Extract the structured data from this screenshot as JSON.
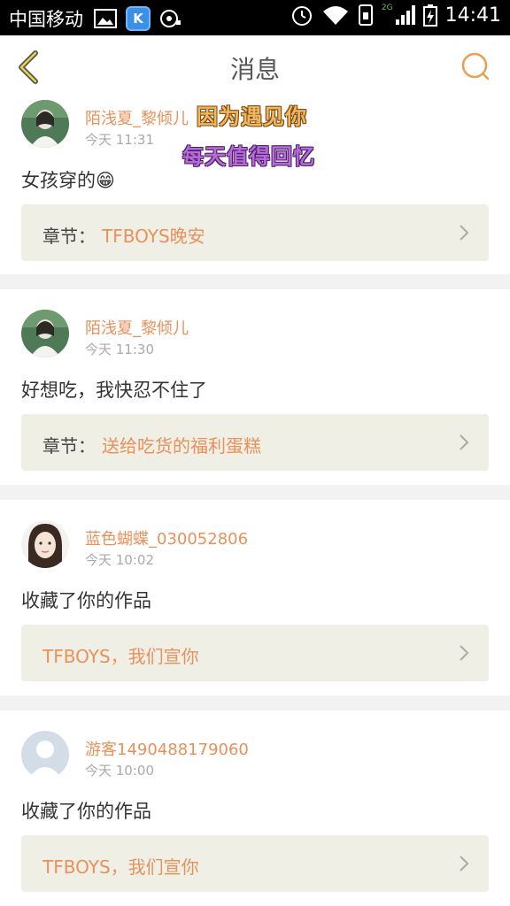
{
  "status_bar": {
    "carrier": "中国移动",
    "k_app_letter": "K",
    "network_label": "2G",
    "time": "14:41"
  },
  "header": {
    "title": "消息",
    "accent_color": "#e8a054"
  },
  "overlay": {
    "line1": "因为遇见你",
    "line2": "每天值得回忆"
  },
  "messages": [
    {
      "username": "陌浅夏_黎倾儿",
      "time": "今天 11:31",
      "text": "女孩穿的😁",
      "link_prefix": "章节：",
      "link_title": "TFBOYS晚安"
    },
    {
      "username": "陌浅夏_黎倾儿",
      "time": "今天 11:30",
      "text": "好想吃，我快忍不住了",
      "link_prefix": "章节：",
      "link_title": "送给吃货的福利蛋糕"
    },
    {
      "username": "蓝色蝴蝶_030052806",
      "time": "今天 10:02",
      "text": "收藏了你的作品",
      "link_prefix": "",
      "link_title": "TFBOYS，我们宣你"
    },
    {
      "username": "游客1490488179060",
      "time": "今天 10:00",
      "text": "收藏了你的作品",
      "link_prefix": "",
      "link_title": "TFBOYS，我们宣你"
    }
  ]
}
